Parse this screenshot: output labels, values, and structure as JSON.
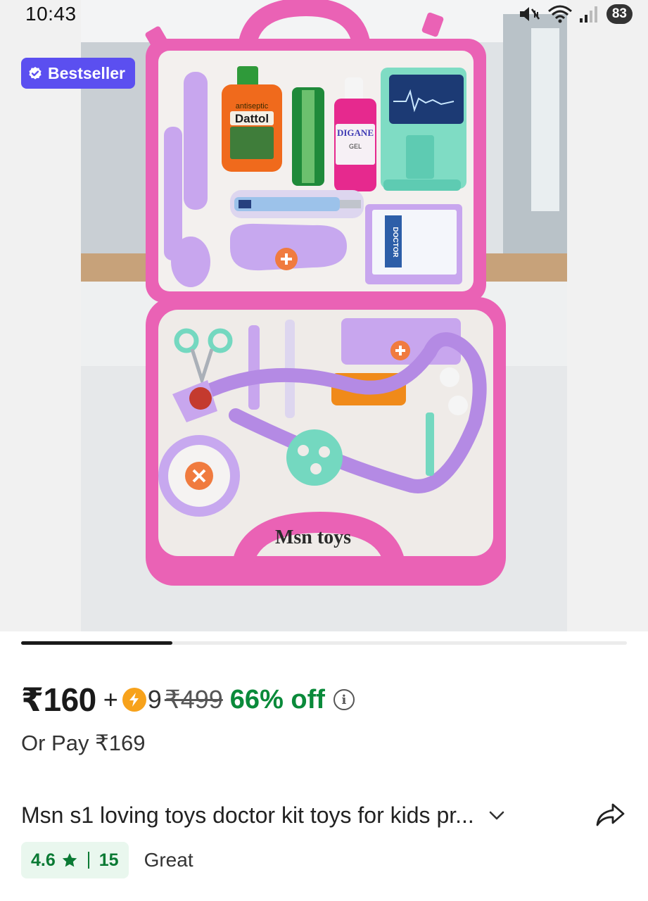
{
  "status_bar": {
    "time": "10:43",
    "battery": "83",
    "icons": [
      "mute-vibrate-icon",
      "wifi-icon",
      "cell-signal-icon",
      "battery-icon"
    ]
  },
  "gallery": {
    "badge": {
      "label": "Bestseller",
      "icon": "verified-check-icon",
      "color": "#5b4ff0"
    },
    "watermark": "Msn toys",
    "pager": {
      "pages_total": 4,
      "current_page": 1,
      "progress": 0.25
    },
    "photo_labels": {
      "bottle_brand": "Dattol",
      "bottle_small_text": "antiseptic",
      "gel_brand": "DIGANE",
      "gel_label": "GEL",
      "card_text": "DOCTOR"
    }
  },
  "price": {
    "current": "₹160",
    "plus": "+",
    "coins": "9",
    "mrp": "₹499",
    "discount": "66% off",
    "discount_color": "#0a8a3a",
    "coin_icon": "lightning-coin-icon",
    "info_icon": "info-icon"
  },
  "or_pay": "Or Pay ₹169",
  "title": {
    "text": "Msn s1 loving toys doctor kit toys for kids pr...",
    "chevron_icon": "chevron-down-icon",
    "share_icon": "share-icon"
  },
  "rating": {
    "value": "4.6",
    "count": "15",
    "label": "Great",
    "star_icon": "star-icon",
    "color": "#0a7a34"
  }
}
